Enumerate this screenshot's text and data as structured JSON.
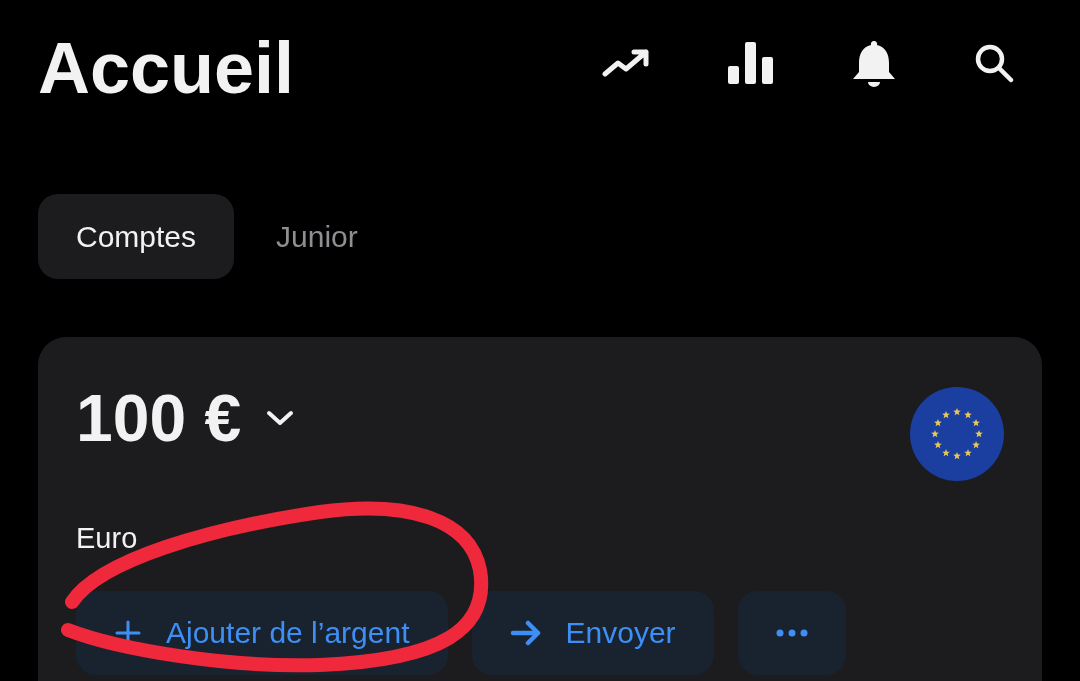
{
  "header": {
    "title": "Accueil"
  },
  "tabs": [
    {
      "label": "Comptes",
      "selected": true
    },
    {
      "label": "Junior",
      "selected": false
    }
  ],
  "account": {
    "amount": "100 €",
    "currency_name": "Euro",
    "actions": [
      {
        "kind": "add",
        "label": "Ajouter de l’argent"
      },
      {
        "kind": "send",
        "label": "Envoyer"
      },
      {
        "kind": "more"
      }
    ]
  },
  "annotation": {
    "kind": "circle",
    "color": "#f0283c"
  }
}
